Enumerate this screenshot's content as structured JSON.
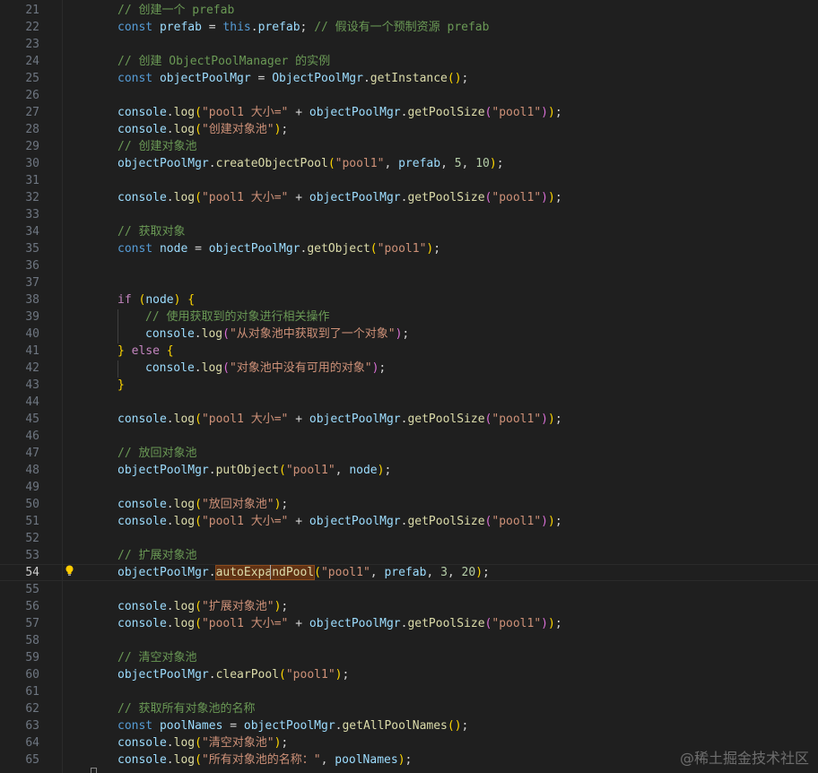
{
  "editor": {
    "current_line": 54,
    "watermark": "@稀土掘金技术社区",
    "lines": [
      {
        "n": "21",
        "indent": 0,
        "tokens": [
          {
            "t": "// 创建一个 prefab",
            "c": "cmt"
          }
        ]
      },
      {
        "n": "22",
        "indent": 0,
        "tokens": [
          {
            "t": "const ",
            "c": "kw"
          },
          {
            "t": "prefab",
            "c": "var"
          },
          {
            "t": " = ",
            "c": "op"
          },
          {
            "t": "this",
            "c": "kw"
          },
          {
            "t": ".",
            "c": "op"
          },
          {
            "t": "prefab",
            "c": "var"
          },
          {
            "t": "; ",
            "c": "op"
          },
          {
            "t": "// 假设有一个预制资源 prefab",
            "c": "cmt"
          }
        ]
      },
      {
        "n": "23",
        "indent": 0,
        "tokens": []
      },
      {
        "n": "24",
        "indent": 0,
        "tokens": [
          {
            "t": "// 创建 ObjectPoolManager 的实例",
            "c": "cmt"
          }
        ]
      },
      {
        "n": "25",
        "indent": 0,
        "tokens": [
          {
            "t": "const ",
            "c": "kw"
          },
          {
            "t": "objectPoolMgr",
            "c": "var"
          },
          {
            "t": " = ",
            "c": "op"
          },
          {
            "t": "ObjectPoolMgr",
            "c": "var"
          },
          {
            "t": ".",
            "c": "op"
          },
          {
            "t": "getInstance",
            "c": "fn"
          },
          {
            "t": "()",
            "c": "p1"
          },
          {
            "t": ";",
            "c": "op"
          }
        ]
      },
      {
        "n": "26",
        "indent": 0,
        "tokens": []
      },
      {
        "n": "27",
        "indent": 0,
        "tokens": [
          {
            "t": "console",
            "c": "var"
          },
          {
            "t": ".",
            "c": "op"
          },
          {
            "t": "log",
            "c": "fn"
          },
          {
            "t": "(",
            "c": "p1"
          },
          {
            "t": "\"pool1 大小=\"",
            "c": "str"
          },
          {
            "t": " + ",
            "c": "op"
          },
          {
            "t": "objectPoolMgr",
            "c": "var"
          },
          {
            "t": ".",
            "c": "op"
          },
          {
            "t": "getPoolSize",
            "c": "fn"
          },
          {
            "t": "(",
            "c": "p2"
          },
          {
            "t": "\"pool1\"",
            "c": "str"
          },
          {
            "t": ")",
            "c": "p2"
          },
          {
            "t": ")",
            "c": "p1"
          },
          {
            "t": ";",
            "c": "op"
          }
        ]
      },
      {
        "n": "28",
        "indent": 0,
        "tokens": [
          {
            "t": "console",
            "c": "var"
          },
          {
            "t": ".",
            "c": "op"
          },
          {
            "t": "log",
            "c": "fn"
          },
          {
            "t": "(",
            "c": "p1"
          },
          {
            "t": "\"创建对象池\"",
            "c": "str"
          },
          {
            "t": ")",
            "c": "p1"
          },
          {
            "t": ";",
            "c": "op"
          }
        ]
      },
      {
        "n": "29",
        "indent": 0,
        "tokens": [
          {
            "t": "// 创建对象池",
            "c": "cmt"
          }
        ]
      },
      {
        "n": "30",
        "indent": 0,
        "tokens": [
          {
            "t": "objectPoolMgr",
            "c": "var"
          },
          {
            "t": ".",
            "c": "op"
          },
          {
            "t": "createObjectPool",
            "c": "fn"
          },
          {
            "t": "(",
            "c": "p1"
          },
          {
            "t": "\"pool1\"",
            "c": "str"
          },
          {
            "t": ", ",
            "c": "op"
          },
          {
            "t": "prefab",
            "c": "var"
          },
          {
            "t": ", ",
            "c": "op"
          },
          {
            "t": "5",
            "c": "num"
          },
          {
            "t": ", ",
            "c": "op"
          },
          {
            "t": "10",
            "c": "num"
          },
          {
            "t": ")",
            "c": "p1"
          },
          {
            "t": ";",
            "c": "op"
          }
        ]
      },
      {
        "n": "31",
        "indent": 0,
        "tokens": []
      },
      {
        "n": "32",
        "indent": 0,
        "tokens": [
          {
            "t": "console",
            "c": "var"
          },
          {
            "t": ".",
            "c": "op"
          },
          {
            "t": "log",
            "c": "fn"
          },
          {
            "t": "(",
            "c": "p1"
          },
          {
            "t": "\"pool1 大小=\"",
            "c": "str"
          },
          {
            "t": " + ",
            "c": "op"
          },
          {
            "t": "objectPoolMgr",
            "c": "var"
          },
          {
            "t": ".",
            "c": "op"
          },
          {
            "t": "getPoolSize",
            "c": "fn"
          },
          {
            "t": "(",
            "c": "p2"
          },
          {
            "t": "\"pool1\"",
            "c": "str"
          },
          {
            "t": ")",
            "c": "p2"
          },
          {
            "t": ")",
            "c": "p1"
          },
          {
            "t": ";",
            "c": "op"
          }
        ]
      },
      {
        "n": "33",
        "indent": 0,
        "tokens": []
      },
      {
        "n": "34",
        "indent": 0,
        "tokens": [
          {
            "t": "// 获取对象",
            "c": "cmt"
          }
        ]
      },
      {
        "n": "35",
        "indent": 0,
        "tokens": [
          {
            "t": "const ",
            "c": "kw"
          },
          {
            "t": "node",
            "c": "var"
          },
          {
            "t": " = ",
            "c": "op"
          },
          {
            "t": "objectPoolMgr",
            "c": "var"
          },
          {
            "t": ".",
            "c": "op"
          },
          {
            "t": "getObject",
            "c": "fn"
          },
          {
            "t": "(",
            "c": "p1"
          },
          {
            "t": "\"pool1\"",
            "c": "str"
          },
          {
            "t": ")",
            "c": "p1"
          },
          {
            "t": ";",
            "c": "op"
          }
        ]
      },
      {
        "n": "36",
        "indent": 0,
        "tokens": []
      },
      {
        "n": "37",
        "indent": 0,
        "tokens": []
      },
      {
        "n": "38",
        "indent": 0,
        "tokens": [
          {
            "t": "if ",
            "c": "ctrl"
          },
          {
            "t": "(",
            "c": "p1"
          },
          {
            "t": "node",
            "c": "var"
          },
          {
            "t": ") ",
            "c": "p1"
          },
          {
            "t": "{",
            "c": "p1"
          }
        ]
      },
      {
        "n": "39",
        "indent": 1,
        "tokens": [
          {
            "t": "// 使用获取到的对象进行相关操作",
            "c": "cmt"
          }
        ]
      },
      {
        "n": "40",
        "indent": 1,
        "tokens": [
          {
            "t": "console",
            "c": "var"
          },
          {
            "t": ".",
            "c": "op"
          },
          {
            "t": "log",
            "c": "fn"
          },
          {
            "t": "(",
            "c": "p2"
          },
          {
            "t": "\"从对象池中获取到了一个对象\"",
            "c": "str"
          },
          {
            "t": ")",
            "c": "p2"
          },
          {
            "t": ";",
            "c": "op"
          }
        ]
      },
      {
        "n": "41",
        "indent": 0,
        "tokens": [
          {
            "t": "}",
            "c": "p1"
          },
          {
            "t": " ",
            "c": "op"
          },
          {
            "t": "else ",
            "c": "ctrl"
          },
          {
            "t": "{",
            "c": "p1"
          }
        ]
      },
      {
        "n": "42",
        "indent": 1,
        "tokens": [
          {
            "t": "console",
            "c": "var"
          },
          {
            "t": ".",
            "c": "op"
          },
          {
            "t": "log",
            "c": "fn"
          },
          {
            "t": "(",
            "c": "p2"
          },
          {
            "t": "\"对象池中没有可用的对象\"",
            "c": "str"
          },
          {
            "t": ")",
            "c": "p2"
          },
          {
            "t": ";",
            "c": "op"
          }
        ]
      },
      {
        "n": "43",
        "indent": 0,
        "tokens": [
          {
            "t": "}",
            "c": "p1"
          }
        ]
      },
      {
        "n": "44",
        "indent": 0,
        "tokens": []
      },
      {
        "n": "45",
        "indent": 0,
        "tokens": [
          {
            "t": "console",
            "c": "var"
          },
          {
            "t": ".",
            "c": "op"
          },
          {
            "t": "log",
            "c": "fn"
          },
          {
            "t": "(",
            "c": "p1"
          },
          {
            "t": "\"pool1 大小=\"",
            "c": "str"
          },
          {
            "t": " + ",
            "c": "op"
          },
          {
            "t": "objectPoolMgr",
            "c": "var"
          },
          {
            "t": ".",
            "c": "op"
          },
          {
            "t": "getPoolSize",
            "c": "fn"
          },
          {
            "t": "(",
            "c": "p2"
          },
          {
            "t": "\"pool1\"",
            "c": "str"
          },
          {
            "t": ")",
            "c": "p2"
          },
          {
            "t": ")",
            "c": "p1"
          },
          {
            "t": ";",
            "c": "op"
          }
        ]
      },
      {
        "n": "46",
        "indent": 0,
        "tokens": []
      },
      {
        "n": "47",
        "indent": 0,
        "tokens": [
          {
            "t": "// 放回对象池",
            "c": "cmt"
          }
        ]
      },
      {
        "n": "48",
        "indent": 0,
        "tokens": [
          {
            "t": "objectPoolMgr",
            "c": "var"
          },
          {
            "t": ".",
            "c": "op"
          },
          {
            "t": "putObject",
            "c": "fn"
          },
          {
            "t": "(",
            "c": "p1"
          },
          {
            "t": "\"pool1\"",
            "c": "str"
          },
          {
            "t": ", ",
            "c": "op"
          },
          {
            "t": "node",
            "c": "var"
          },
          {
            "t": ")",
            "c": "p1"
          },
          {
            "t": ";",
            "c": "op"
          }
        ]
      },
      {
        "n": "49",
        "indent": 0,
        "tokens": []
      },
      {
        "n": "50",
        "indent": 0,
        "tokens": [
          {
            "t": "console",
            "c": "var"
          },
          {
            "t": ".",
            "c": "op"
          },
          {
            "t": "log",
            "c": "fn"
          },
          {
            "t": "(",
            "c": "p1"
          },
          {
            "t": "\"放回对象池\"",
            "c": "str"
          },
          {
            "t": ")",
            "c": "p1"
          },
          {
            "t": ";",
            "c": "op"
          }
        ]
      },
      {
        "n": "51",
        "indent": 0,
        "tokens": [
          {
            "t": "console",
            "c": "var"
          },
          {
            "t": ".",
            "c": "op"
          },
          {
            "t": "log",
            "c": "fn"
          },
          {
            "t": "(",
            "c": "p1"
          },
          {
            "t": "\"pool1 大小=\"",
            "c": "str"
          },
          {
            "t": " + ",
            "c": "op"
          },
          {
            "t": "objectPoolMgr",
            "c": "var"
          },
          {
            "t": ".",
            "c": "op"
          },
          {
            "t": "getPoolSize",
            "c": "fn"
          },
          {
            "t": "(",
            "c": "p2"
          },
          {
            "t": "\"pool1\"",
            "c": "str"
          },
          {
            "t": ")",
            "c": "p2"
          },
          {
            "t": ")",
            "c": "p1"
          },
          {
            "t": ";",
            "c": "op"
          }
        ]
      },
      {
        "n": "52",
        "indent": 0,
        "tokens": []
      },
      {
        "n": "53",
        "indent": 0,
        "tokens": [
          {
            "t": "// 扩展对象池",
            "c": "cmt"
          }
        ]
      },
      {
        "n": "54",
        "indent": 0,
        "tokens": [
          {
            "t": "objectPoolMgr",
            "c": "var"
          },
          {
            "t": ".",
            "c": "op"
          },
          {
            "t": "autoExpandPool",
            "c": "fn hl"
          },
          {
            "t": "(",
            "c": "p1"
          },
          {
            "t": "\"pool1\"",
            "c": "str"
          },
          {
            "t": ", ",
            "c": "op"
          },
          {
            "t": "prefab",
            "c": "var"
          },
          {
            "t": ", ",
            "c": "op"
          },
          {
            "t": "3",
            "c": "num"
          },
          {
            "t": ", ",
            "c": "op"
          },
          {
            "t": "20",
            "c": "num"
          },
          {
            "t": ")",
            "c": "p1"
          },
          {
            "t": ";",
            "c": "op"
          }
        ]
      },
      {
        "n": "55",
        "indent": 0,
        "tokens": []
      },
      {
        "n": "56",
        "indent": 0,
        "tokens": [
          {
            "t": "console",
            "c": "var"
          },
          {
            "t": ".",
            "c": "op"
          },
          {
            "t": "log",
            "c": "fn"
          },
          {
            "t": "(",
            "c": "p1"
          },
          {
            "t": "\"扩展对象池\"",
            "c": "str"
          },
          {
            "t": ")",
            "c": "p1"
          },
          {
            "t": ";",
            "c": "op"
          }
        ]
      },
      {
        "n": "57",
        "indent": 0,
        "tokens": [
          {
            "t": "console",
            "c": "var"
          },
          {
            "t": ".",
            "c": "op"
          },
          {
            "t": "log",
            "c": "fn"
          },
          {
            "t": "(",
            "c": "p1"
          },
          {
            "t": "\"pool1 大小=\"",
            "c": "str"
          },
          {
            "t": " + ",
            "c": "op"
          },
          {
            "t": "objectPoolMgr",
            "c": "var"
          },
          {
            "t": ".",
            "c": "op"
          },
          {
            "t": "getPoolSize",
            "c": "fn"
          },
          {
            "t": "(",
            "c": "p2"
          },
          {
            "t": "\"pool1\"",
            "c": "str"
          },
          {
            "t": ")",
            "c": "p2"
          },
          {
            "t": ")",
            "c": "p1"
          },
          {
            "t": ";",
            "c": "op"
          }
        ]
      },
      {
        "n": "58",
        "indent": 0,
        "tokens": []
      },
      {
        "n": "59",
        "indent": 0,
        "tokens": [
          {
            "t": "// 清空对象池",
            "c": "cmt"
          }
        ]
      },
      {
        "n": "60",
        "indent": 0,
        "tokens": [
          {
            "t": "objectPoolMgr",
            "c": "var"
          },
          {
            "t": ".",
            "c": "op"
          },
          {
            "t": "clearPool",
            "c": "fn"
          },
          {
            "t": "(",
            "c": "p1"
          },
          {
            "t": "\"pool1\"",
            "c": "str"
          },
          {
            "t": ")",
            "c": "p1"
          },
          {
            "t": ";",
            "c": "op"
          }
        ]
      },
      {
        "n": "61",
        "indent": 0,
        "tokens": []
      },
      {
        "n": "62",
        "indent": 0,
        "tokens": [
          {
            "t": "// 获取所有对象池的名称",
            "c": "cmt"
          }
        ]
      },
      {
        "n": "63",
        "indent": 0,
        "tokens": [
          {
            "t": "const ",
            "c": "kw"
          },
          {
            "t": "poolNames",
            "c": "var"
          },
          {
            "t": " = ",
            "c": "op"
          },
          {
            "t": "objectPoolMgr",
            "c": "var"
          },
          {
            "t": ".",
            "c": "op"
          },
          {
            "t": "getAllPoolNames",
            "c": "fn"
          },
          {
            "t": "()",
            "c": "p1"
          },
          {
            "t": ";",
            "c": "op"
          }
        ]
      },
      {
        "n": "64",
        "indent": 0,
        "tokens": [
          {
            "t": "console",
            "c": "var"
          },
          {
            "t": ".",
            "c": "op"
          },
          {
            "t": "log",
            "c": "fn"
          },
          {
            "t": "(",
            "c": "p1"
          },
          {
            "t": "\"清空对象池\"",
            "c": "str"
          },
          {
            "t": ")",
            "c": "p1"
          },
          {
            "t": ";",
            "c": "op"
          }
        ]
      },
      {
        "n": "65",
        "indent": 0,
        "tokens": [
          {
            "t": "console",
            "c": "var"
          },
          {
            "t": ".",
            "c": "op"
          },
          {
            "t": "log",
            "c": "fn"
          },
          {
            "t": "(",
            "c": "p1"
          },
          {
            "t": "\"所有对象池的名称：\"",
            "c": "str"
          },
          {
            "t": ", ",
            "c": "op"
          },
          {
            "t": "poolNames",
            "c": "var"
          },
          {
            "t": ")",
            "c": "p1"
          },
          {
            "t": ";",
            "c": "op"
          }
        ]
      }
    ]
  },
  "icons": {
    "lightbulb": "lightbulb-icon",
    "fold": "fold-marker-icon"
  },
  "colors": {
    "background": "#1f1f1f",
    "keyword": "#569cd6",
    "variable": "#9cdcfe",
    "function": "#dcdcaa",
    "string": "#ce9178",
    "number": "#b5cea8",
    "comment": "#6a9955",
    "highlight": "#613214"
  }
}
